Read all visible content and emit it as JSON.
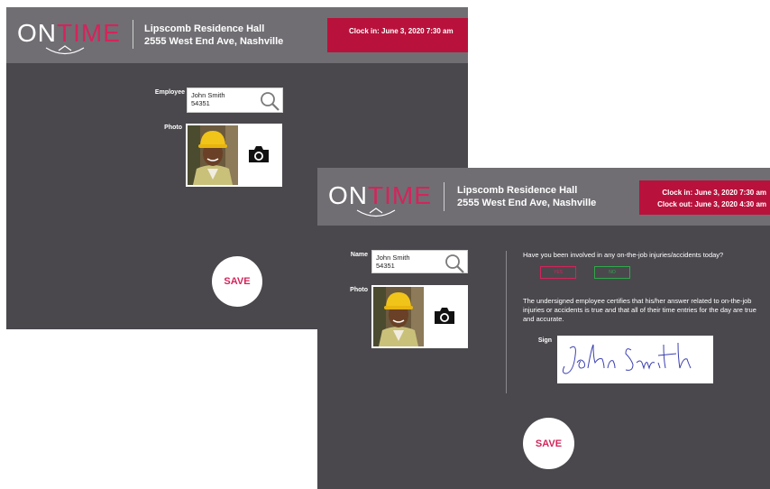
{
  "brand": {
    "on": "ON",
    "time": "TIME"
  },
  "location": {
    "name": "Lipscomb Residence Hall",
    "address": "2555 West End Ave, Nashville"
  },
  "screen1": {
    "clock_in": "Clock in: June 3, 2020 7:30 am",
    "employee_label": "Employee",
    "employee_name": "John Smith",
    "employee_id": "54351",
    "photo_label": "Photo",
    "save_label": "SAVE"
  },
  "screen2": {
    "clock_in": "Clock in: June 3, 2020 7:30 am",
    "clock_out": "Clock out: June 3, 2020 4:30 am",
    "name_label": "Name",
    "employee_name": "John Smith",
    "employee_id": "54351",
    "photo_label": "Photo",
    "question": "Have you been involved in any on-the-job injuries/accidents today?",
    "yes_label": "YES",
    "no_label": "NO",
    "certification": "The undersigned employee certifies that his/her answer related to on-the-job injuries or accidents is true and that all of their time entries for the day are true and accurate.",
    "sign_label": "Sign",
    "signature": "John Smith",
    "save_label": "SAVE"
  },
  "colors": {
    "panel": "#4a484d",
    "header": "#706e73",
    "accent": "#d4245b",
    "clock_bg": "#b8123c",
    "no_green": "#2fa84a"
  },
  "icons": [
    "search-icon",
    "camera-icon",
    "logo-smile-icon"
  ]
}
